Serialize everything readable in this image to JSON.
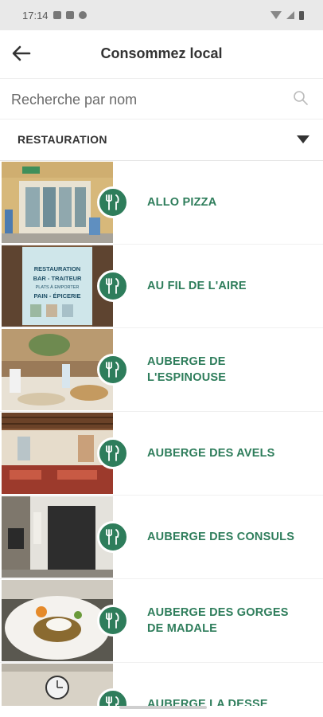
{
  "status_bar": {
    "time": "17:14"
  },
  "app_bar": {
    "title": "Consommez local"
  },
  "search": {
    "placeholder": "Recherche par nom"
  },
  "category": {
    "selected": "RESTAURATION"
  },
  "items": [
    {
      "name": "ALLO PIZZA"
    },
    {
      "name": "AU FIL DE L'AIRE"
    },
    {
      "name": "AUBERGE DE L'ESPINOUSE"
    },
    {
      "name": "AUBERGE DES AVELS"
    },
    {
      "name": "AUBERGE DES CONSULS"
    },
    {
      "name": "AUBERGE DES GORGES DE MADALE"
    },
    {
      "name": "AUBERGE LA DESSE"
    }
  ],
  "thumb_signage": {
    "line1": "RESTAURATION",
    "line2": "BAR - TRAITEUR",
    "line3": "PLATS À EMPORTER",
    "line4": "PAIN - ÉPICERIE"
  },
  "colors": {
    "accent": "#2e7d5b",
    "status_bar": "#e9e9e9"
  },
  "icons": [
    "back-arrow-icon",
    "search-icon",
    "dropdown-caret-icon",
    "restaurant-icon"
  ]
}
